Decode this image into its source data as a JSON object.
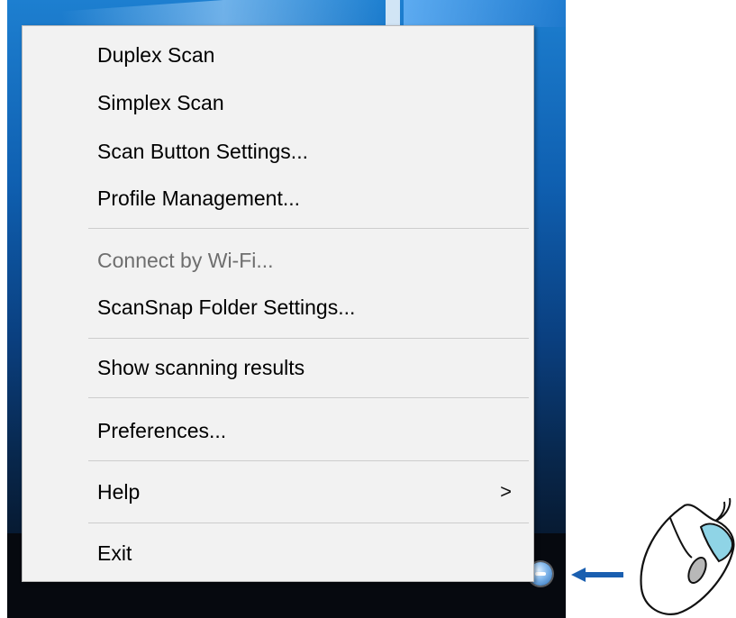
{
  "menu": {
    "items": [
      {
        "label": "Duplex Scan",
        "enabled": true
      },
      {
        "label": "Simplex Scan",
        "enabled": true
      },
      {
        "label": "Scan Button Settings...",
        "enabled": true
      },
      {
        "label": "Profile Management...",
        "enabled": true
      },
      {
        "label": "Connect by Wi-Fi...",
        "enabled": false
      },
      {
        "label": "ScanSnap Folder Settings...",
        "enabled": true
      },
      {
        "label": "Show scanning results",
        "enabled": true
      },
      {
        "label": "Preferences...",
        "enabled": true
      },
      {
        "label": "Help",
        "enabled": true,
        "submenu_indicator": ">"
      },
      {
        "label": "Exit",
        "enabled": true
      }
    ]
  },
  "tray": {
    "icon": "scansnap-manager-icon"
  },
  "pointer": {
    "arrow_color": "#1a5fb0",
    "mouse_button_color": "#8fd4e6"
  }
}
